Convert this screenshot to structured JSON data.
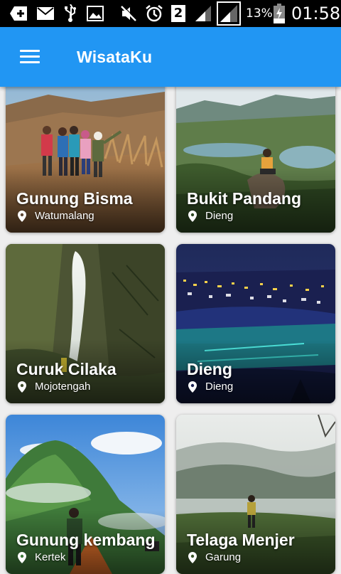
{
  "status_bar": {
    "sim_number": "2",
    "battery_percent": "13%",
    "time": "01:58",
    "icons": [
      "add-box-icon",
      "email-icon",
      "usb-icon",
      "image-icon",
      "mute-icon",
      "alarm-icon",
      "sim-2-icon",
      "signal-icon",
      "signal-boxed-icon",
      "battery-icon"
    ]
  },
  "app_bar": {
    "title": "WisataKu",
    "menu_icon": "hamburger-menu-icon",
    "color": "#2196f3"
  },
  "destinations": [
    {
      "name": "Gunung Bisma",
      "location": "Watumalang"
    },
    {
      "name": "Bukit Pandang",
      "location": "Dieng"
    },
    {
      "name": "Curuk Cilaka",
      "location": "Mojotengah"
    },
    {
      "name": "Dieng",
      "location": "Dieng"
    },
    {
      "name": "Gunung kembang",
      "location": "Kertek"
    },
    {
      "name": "Telaga Menjer",
      "location": "Garung"
    }
  ]
}
